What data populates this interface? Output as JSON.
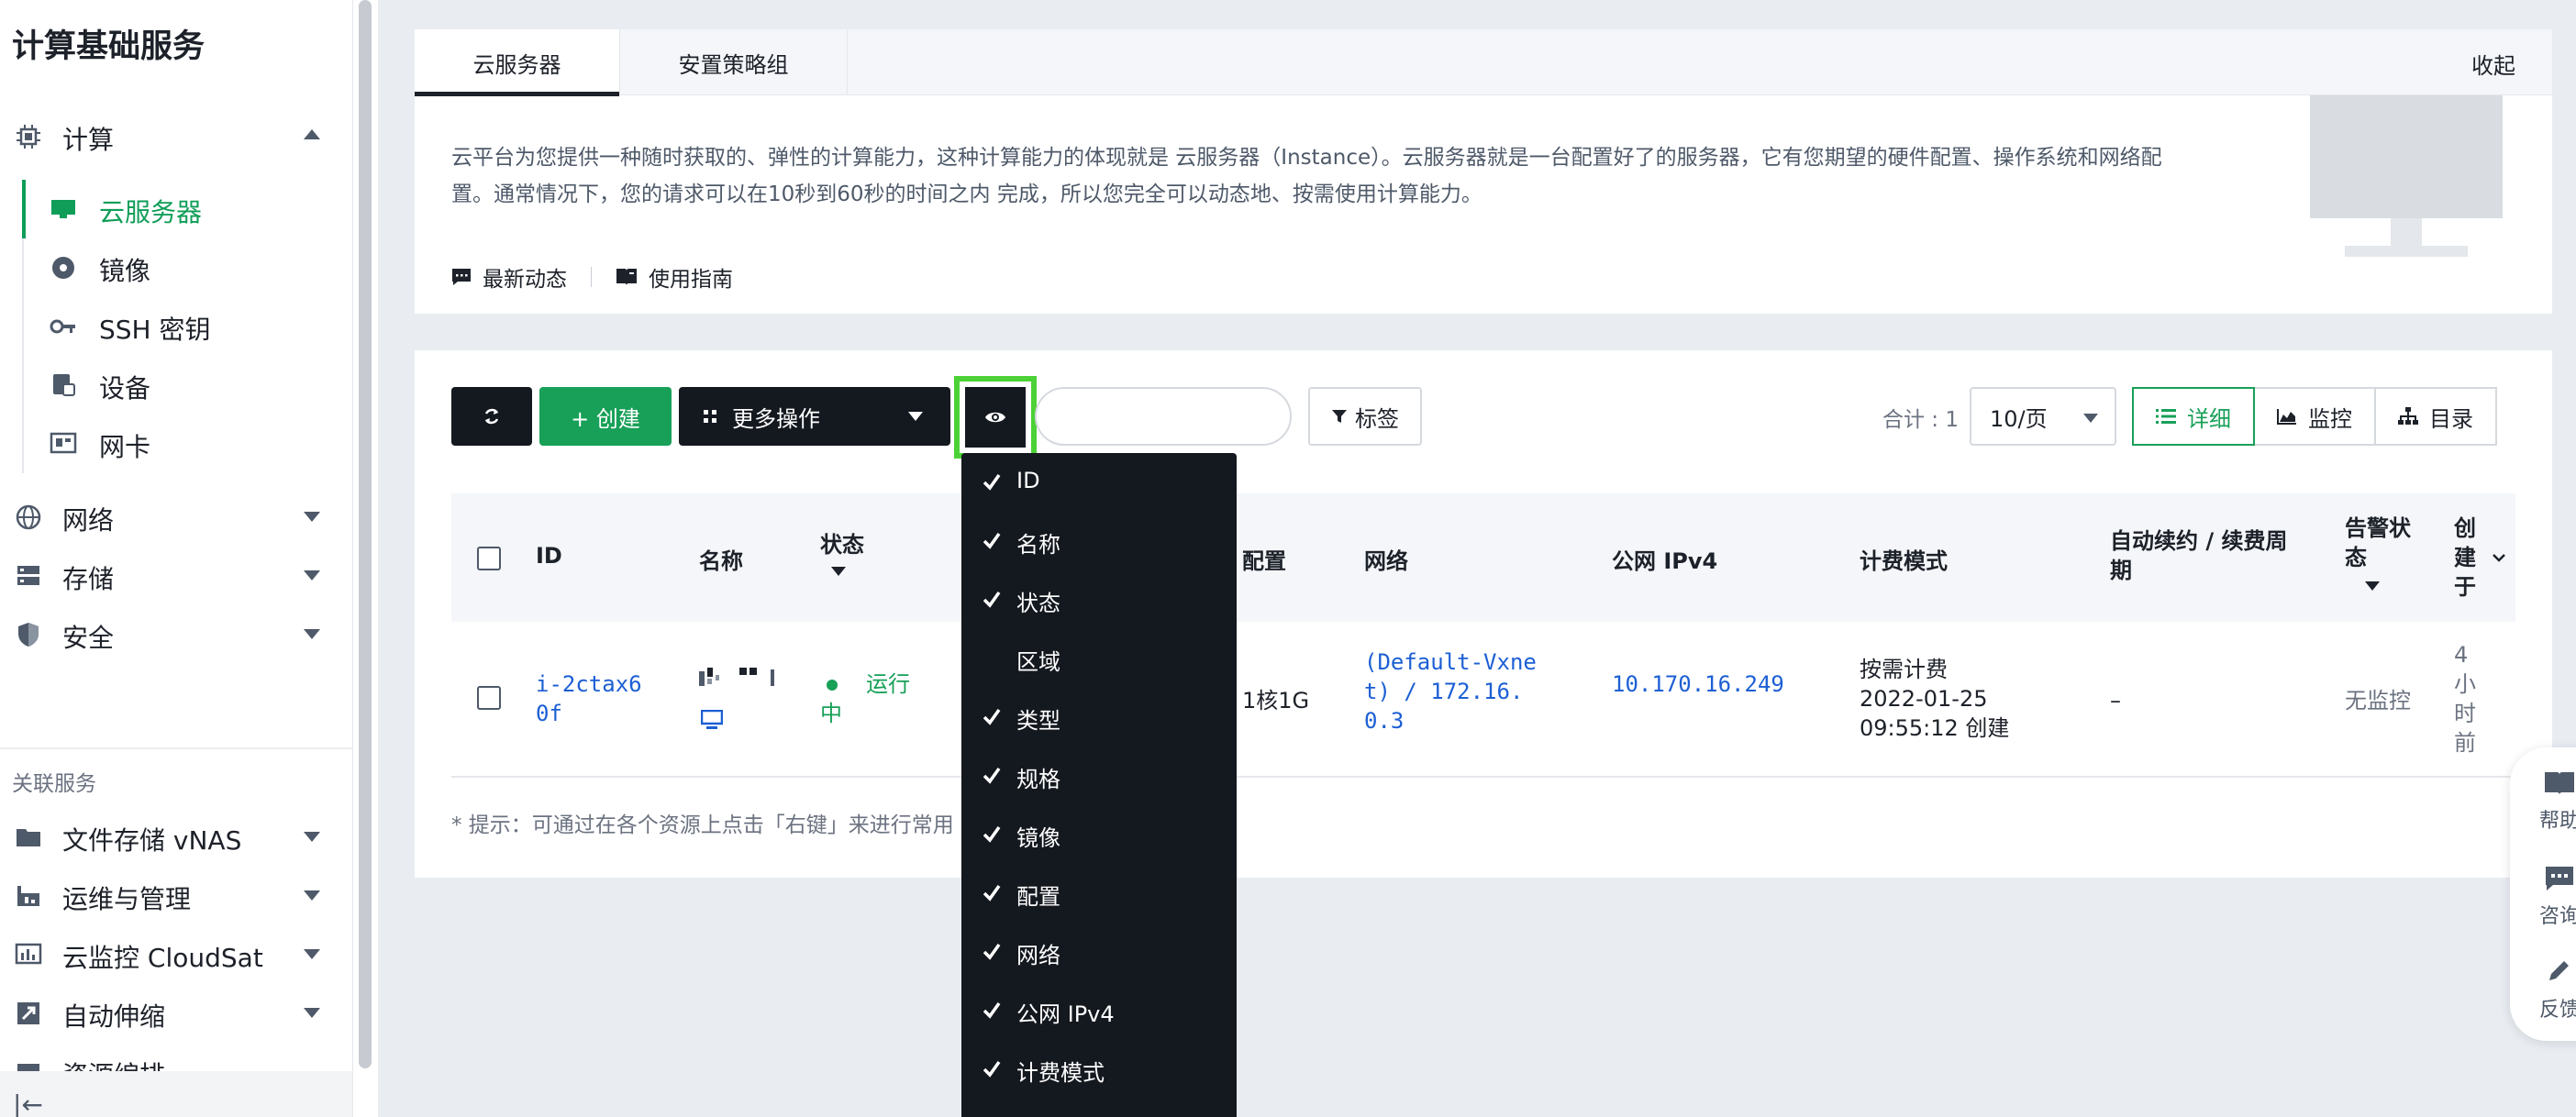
{
  "sidebar": {
    "product_title": "计算基础服务",
    "groups": [
      {
        "label": "计算",
        "icon": "chip-icon",
        "expanded": true
      },
      {
        "label": "网络",
        "icon": "globe-icon",
        "expanded": false
      },
      {
        "label": "存储",
        "icon": "storage-icon",
        "expanded": false
      },
      {
        "label": "安全",
        "icon": "shield-icon",
        "expanded": false
      }
    ],
    "compute_items": [
      {
        "label": "云服务器",
        "icon": "monitor-icon",
        "active": true
      },
      {
        "label": "镜像",
        "icon": "disc-icon",
        "active": false
      },
      {
        "label": "SSH 密钥",
        "icon": "key-icon",
        "active": false
      },
      {
        "label": "设备",
        "icon": "device-icon",
        "active": false
      },
      {
        "label": "网卡",
        "icon": "nic-icon",
        "active": false
      }
    ],
    "related_title": "关联服务",
    "related_items": [
      {
        "label": "文件存储 vNAS",
        "icon": "folder-icon"
      },
      {
        "label": "运维与管理",
        "icon": "ops-icon"
      },
      {
        "label": "云监控 CloudSat",
        "icon": "chart-icon"
      },
      {
        "label": "自动伸缩",
        "icon": "autoscale-icon"
      },
      {
        "label": "资源编排",
        "icon": "orchestration-icon"
      }
    ],
    "collapse_symbol": "|←"
  },
  "tabs": {
    "items": [
      "云服务器",
      "安置策略组"
    ],
    "collapse_label": "收起"
  },
  "intro": {
    "text": "云平台为您提供一种随时获取的、弹性的计算能力，这种计算能力的体现就是 云服务器（Instance）。云服务器就是一台配置好了的服务器，它有您期望的硬件配置、操作系统和网络配置。通常情况下，您的请求可以在10秒到60秒的时间之内 完成，所以您完全可以动态地、按需使用计算能力。",
    "link_news": "最新动态",
    "link_guide": "使用指南"
  },
  "toolbar": {
    "create_label": "+ 创建",
    "more_label": "更多操作",
    "tag_label": "标签",
    "search_placeholder": "",
    "total_label": "合计 : 1",
    "per_page": "10/页",
    "view_detail": "详细",
    "view_monitor": "监控",
    "view_catalog": "目录"
  },
  "table": {
    "headers": {
      "id": "ID",
      "name": "名称",
      "status": "状态",
      "config": "配置",
      "network": "网络",
      "ipv4": "公网 IPv4",
      "billing": "计费模式",
      "renew": "自动续约 / 续费周期",
      "alarm": "告警状态",
      "created": "创建于"
    },
    "row": {
      "id": "i-2ctax60f",
      "status": "运行中",
      "config": "1核1G",
      "network": "(Default-Vxnet) / 172.16.0.3",
      "ipv4": "10.170.16.249",
      "billing_mode": "按需计费",
      "billing_time": "2022-01-25 09:55:12 创建",
      "renew": "–",
      "alarm": "无监控",
      "created": "4小时前"
    }
  },
  "hint": "* 提示：可通过在各个资源上点击「右键」来进行常用",
  "column_menu": {
    "items": [
      {
        "label": "ID",
        "checked": true
      },
      {
        "label": "名称",
        "checked": true
      },
      {
        "label": "状态",
        "checked": true
      },
      {
        "label": "区域",
        "checked": false
      },
      {
        "label": "类型",
        "checked": true
      },
      {
        "label": "规格",
        "checked": true
      },
      {
        "label": "镜像",
        "checked": true
      },
      {
        "label": "配置",
        "checked": true
      },
      {
        "label": "网络",
        "checked": true
      },
      {
        "label": "公网 IPv4",
        "checked": true
      },
      {
        "label": "计费模式",
        "checked": true
      }
    ]
  },
  "float_help": {
    "help": "帮助",
    "consult": "咨询",
    "feedback": "反馈"
  },
  "colors": {
    "accent_green": "#18a058",
    "dark_button": "#14181f",
    "link_blue": "#1c5fd4",
    "highlight": "#4cd137"
  }
}
